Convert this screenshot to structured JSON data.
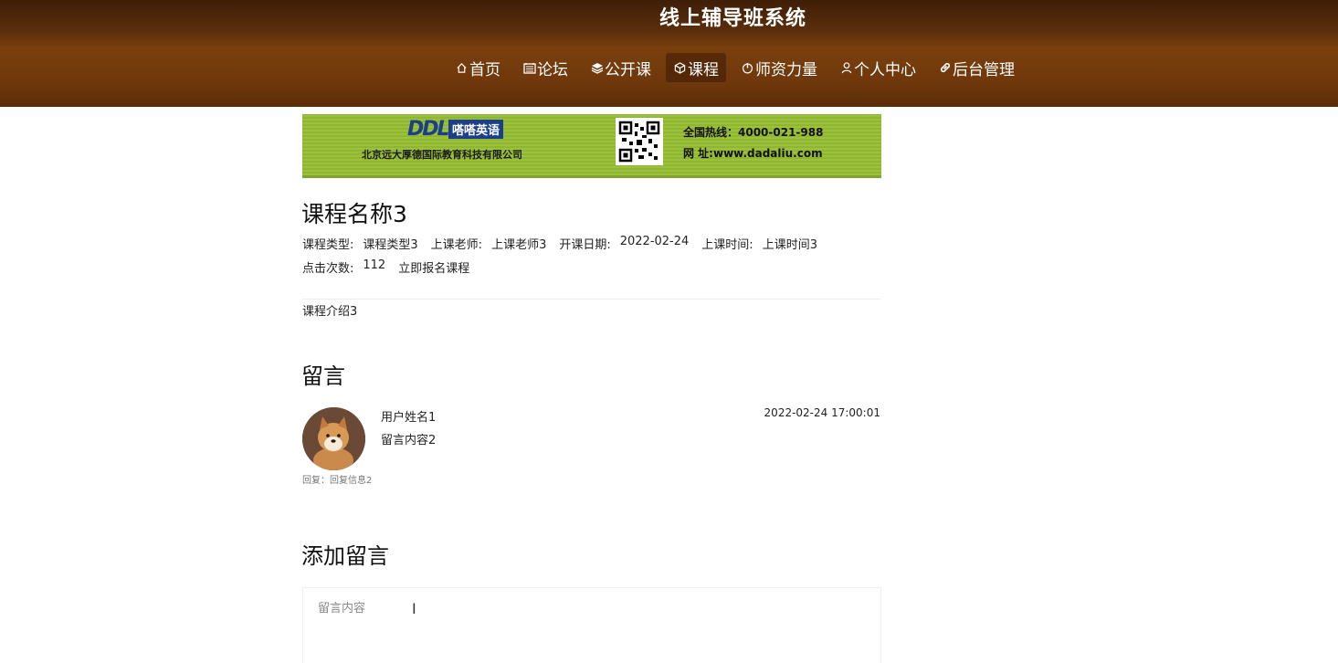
{
  "header": {
    "site_title": "线上辅导班系统",
    "nav": [
      {
        "label": "首页",
        "icon": "home-icon",
        "active": false
      },
      {
        "label": "论坛",
        "icon": "forum-icon",
        "active": false
      },
      {
        "label": "公开课",
        "icon": "layers-icon",
        "active": false
      },
      {
        "label": "课程",
        "icon": "cube-icon",
        "active": true
      },
      {
        "label": "师资力量",
        "icon": "power-icon",
        "active": false
      },
      {
        "label": "个人中心",
        "icon": "user-icon",
        "active": false
      },
      {
        "label": "后台管理",
        "icon": "link-icon",
        "active": false
      }
    ]
  },
  "banner": {
    "logo": "DDL",
    "brand": "嗒嗒英语",
    "company": "北京远大厚德国际教育科技有限公司",
    "hotline": "全国热线：4000-021-988",
    "url": "网  址:www.dadaliu.com"
  },
  "course": {
    "title": "课程名称3",
    "type_label": "课程类型:",
    "type_value": "课程类型3",
    "teacher_label": "上课老师:",
    "teacher_value": "上课老师3",
    "start_label": "开课日期:",
    "start_value": "2022-02-24",
    "time_label": "上课时间:",
    "time_value": "上课时间3",
    "clicks_label": "点击次数:",
    "clicks_value": "112",
    "enroll_label": "立即报名课程",
    "intro": "课程介绍3"
  },
  "comments": {
    "section_title": "留言",
    "items": [
      {
        "user": "用户姓名1",
        "content": "留言内容2",
        "time": "2022-02-24 17:00:01",
        "reply": "回复：回复信息2"
      }
    ]
  },
  "add_comment": {
    "section_title": "添加留言",
    "placeholder": "留言内容"
  }
}
